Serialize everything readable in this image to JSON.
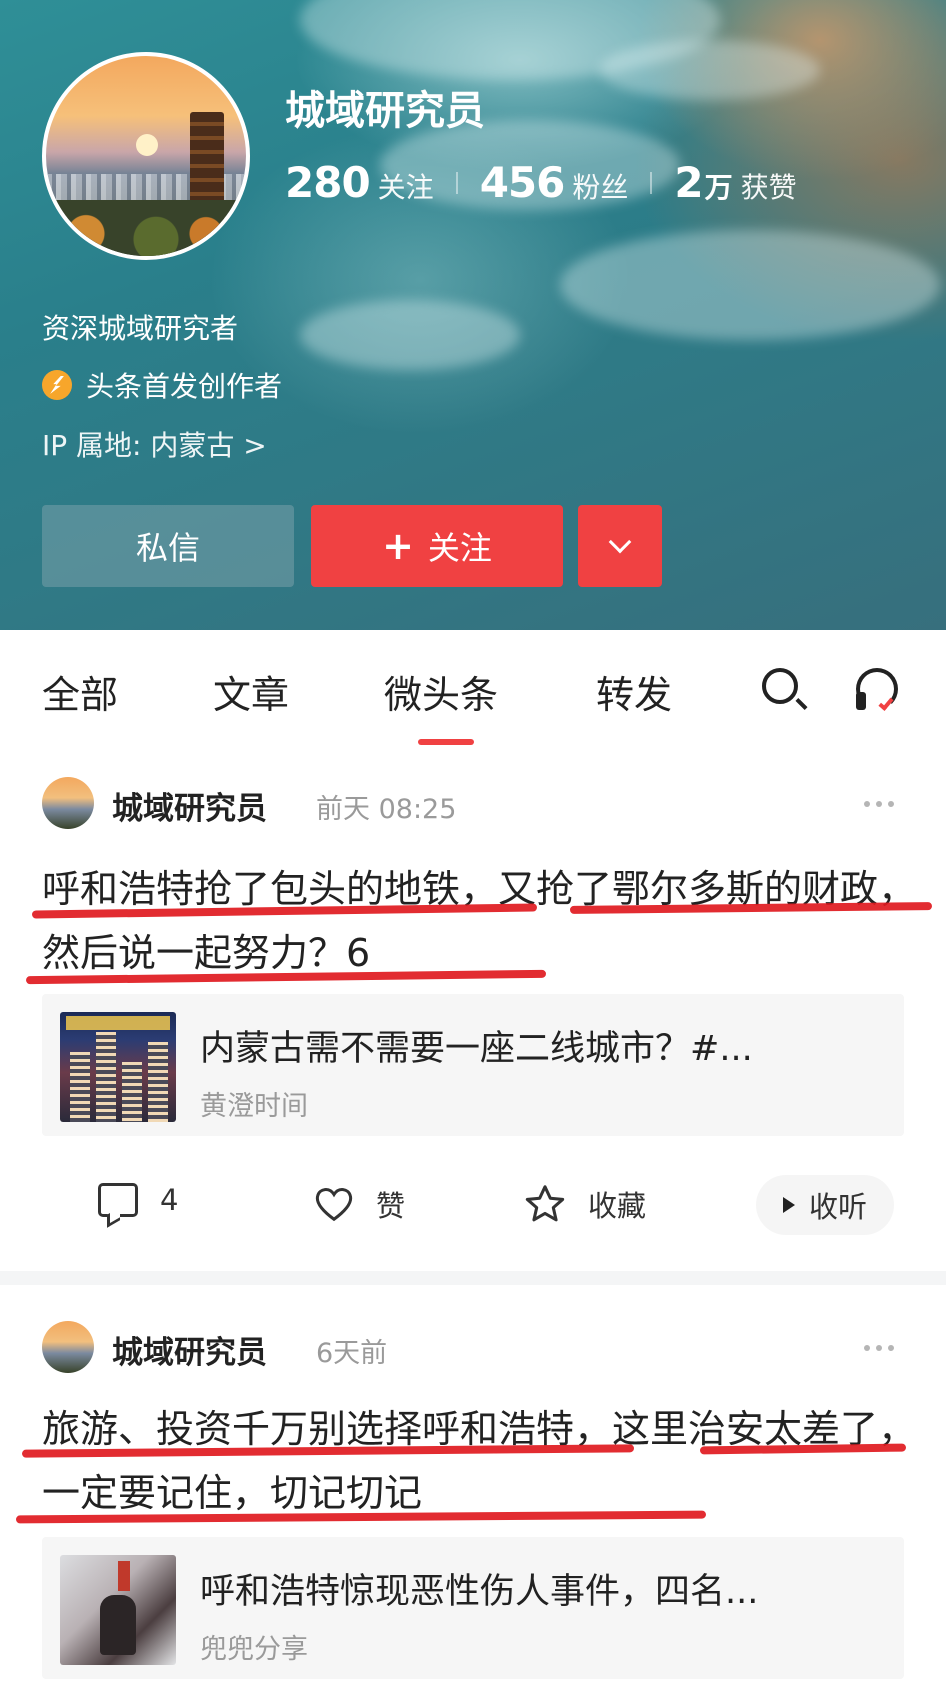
{
  "profile": {
    "name": "城域研究员",
    "stats": [
      {
        "num": "280",
        "unit": "",
        "label": "关注"
      },
      {
        "num": "456",
        "unit": "",
        "label": "粉丝"
      },
      {
        "num": "2",
        "unit": "万",
        "label": "获赞"
      }
    ],
    "bio": "资深城域研究者",
    "creator_badge": "头条首发创作者",
    "ip": "IP 属地: 内蒙古 >",
    "buttons": {
      "message": "私信",
      "follow_plus": "+",
      "follow": "关注"
    }
  },
  "tabs": [
    "全部",
    "文章",
    "微头条",
    "转发"
  ],
  "active_tab": "微头条",
  "posts": [
    {
      "author": "城域研究员",
      "time": "前天  08:25",
      "text": "呼和浩特抢了包头的地铁，又抢了鄂尔多斯的财政，然后说一起努力？6",
      "card": {
        "title": "内蒙古需不需要一座二线城市？#...",
        "source": "黄澄时间"
      },
      "actions": {
        "comments": "4",
        "like": "赞",
        "favorite": "收藏",
        "listen": "收听"
      }
    },
    {
      "author": "城域研究员",
      "time": "6天前",
      "text": "旅游、投资千万别选择呼和浩特，这里治安太差了，一定要记住，切记切记",
      "card": {
        "title": "呼和浩特惊现恶性伤人事件，四名...",
        "source": "兜兜分享"
      }
    }
  ],
  "colors": {
    "accent": "#f04142",
    "underline": "#e01a1f",
    "header_teal": "#2a7f8b"
  }
}
